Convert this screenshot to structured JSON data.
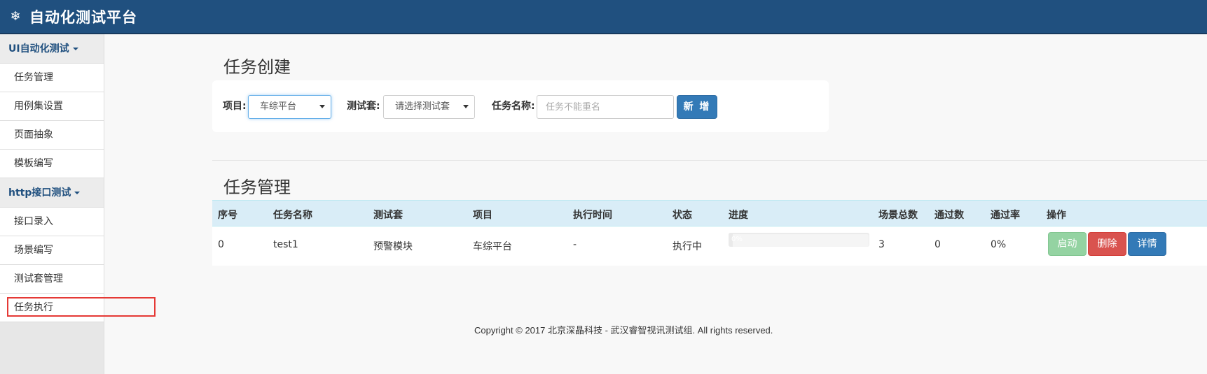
{
  "navbar": {
    "logo_icon": "snowflake-icon",
    "logo_glyph": "❄",
    "title": "自动化测试平台"
  },
  "sidebar": {
    "groups": [
      {
        "label": "UI自动化测试",
        "items": [
          "任务管理",
          "用例集设置",
          "页面抽象",
          "模板编写"
        ]
      },
      {
        "label": "http接口测试",
        "items": [
          "接口录入",
          "场景编写",
          "测试套管理",
          "任务执行"
        ]
      }
    ]
  },
  "create_section": {
    "title": "任务创建",
    "project_label": "项目:",
    "project_value": "车综平台",
    "suite_label": "测试套:",
    "suite_value": "请选择测试套",
    "name_label": "任务名称:",
    "name_placeholder": "任务不能重名",
    "add_button": "新 增"
  },
  "manage_section": {
    "title": "任务管理",
    "columns": [
      "序号",
      "任务名称",
      "测试套",
      "项目",
      "执行时间",
      "状态",
      "进度",
      "场景总数",
      "通过数",
      "通过率",
      "操作"
    ],
    "rows": [
      {
        "index": "0",
        "name": "test1",
        "suite": "预警模块",
        "project": "车综平台",
        "exec_time": "-",
        "status": "执行中",
        "progress": 0,
        "progress_label": "0%",
        "total": "3",
        "passed": "0",
        "pass_rate": "0%",
        "actions": {
          "start": "启动",
          "delete": "删除",
          "detail": "详情"
        }
      }
    ]
  },
  "footer": {
    "text": "Copyright © 2017 北京深晶科技 - 武汉睿智视讯测试组. All rights reserved."
  },
  "colors": {
    "navbar": "#20507f",
    "primary": "#337ab7",
    "danger": "#d9534f",
    "success_disabled": "#8fd19e",
    "highlight": "#e53935"
  }
}
